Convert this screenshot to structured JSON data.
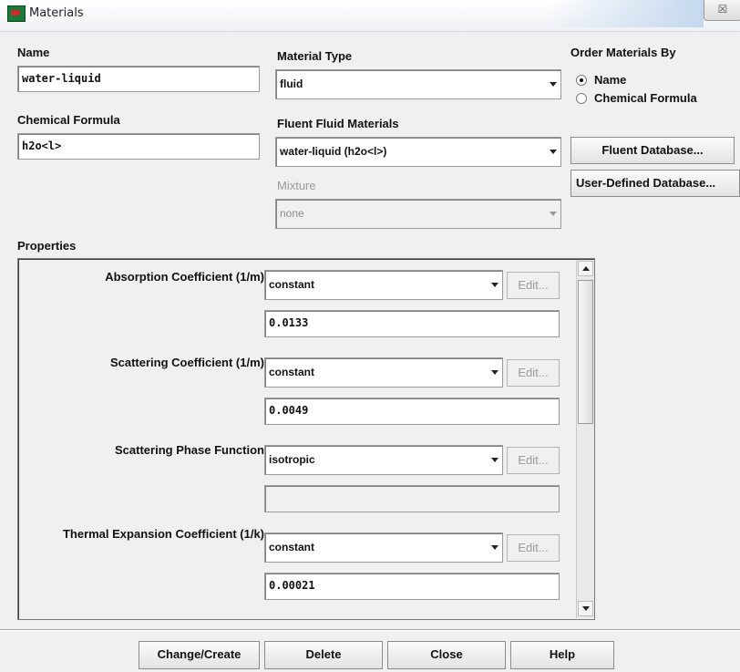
{
  "window": {
    "title": "Materials",
    "close_glyph": "☒"
  },
  "name": {
    "label": "Name",
    "value": "water-liquid"
  },
  "material_type": {
    "label": "Material Type",
    "value": "fluid"
  },
  "order_by": {
    "label": "Order Materials By",
    "options": [
      {
        "label": "Name",
        "checked": true
      },
      {
        "label": "Chemical Formula",
        "checked": false
      }
    ]
  },
  "chemical_formula": {
    "label": "Chemical Formula",
    "value": "h2o<l>"
  },
  "fluent_fluid_materials": {
    "label": "Fluent Fluid Materials",
    "value": "water-liquid (h2o<l>)"
  },
  "mixture": {
    "label": "Mixture",
    "value": "none"
  },
  "buttons": {
    "fluent_database": "Fluent Database...",
    "user_defined_database": "User-Defined Database...",
    "change_create": "Change/Create",
    "delete": "Delete",
    "close": "Close",
    "help": "Help"
  },
  "properties": {
    "label": "Properties",
    "edit_label": "Edit...",
    "items": [
      {
        "label": "Absorption Coefficient (1/m)",
        "method": "constant",
        "value": "0.0133"
      },
      {
        "label": "Scattering Coefficient (1/m)",
        "method": "constant",
        "value": "0.0049"
      },
      {
        "label": "Scattering Phase Function",
        "method": "isotropic",
        "value": ""
      },
      {
        "label": "Thermal Expansion Coefficient (1/k)",
        "method": "constant",
        "value": "0.00021"
      }
    ]
  }
}
